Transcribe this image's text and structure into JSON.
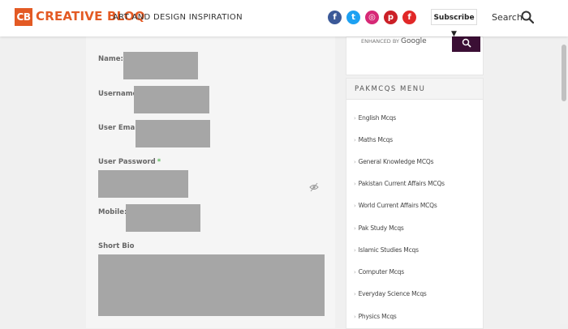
{
  "header": {
    "logo_mark": "CB",
    "logo_text": "CREATIVE BLOQ",
    "tagline": "ART AND DESIGN INSPIRATION",
    "social": [
      {
        "icon": "facebook-icon",
        "glyph": "f",
        "color": "#3b5998"
      },
      {
        "icon": "twitter-icon",
        "glyph": "t",
        "color": "#1da1f2"
      },
      {
        "icon": "instagram-icon",
        "glyph": "◎",
        "color": "#d62976"
      },
      {
        "icon": "pinterest-icon",
        "glyph": "p",
        "color": "#cb2027"
      },
      {
        "icon": "flipboard-icon",
        "glyph": "f",
        "color": "#e12828"
      }
    ],
    "subscribe_label": "Subscribe ▼",
    "search_label": "Search"
  },
  "form": {
    "name_label": "Name:",
    "username_label": "Username",
    "email_label": "User Email",
    "password_label": "User Password",
    "mobile_label": "Mobile:",
    "bio_label": "Short Bio",
    "required_mark": "*"
  },
  "sidebar": {
    "search_enhanced": "ENHANCED BY",
    "search_google": "Google",
    "menu_title": "PAKMCQS MENU",
    "menu_items": [
      "English Mcqs",
      "Maths Mcqs",
      "General Knowledge MCQs",
      "Pakistan Current Affairs MCQs",
      "World Current Affairs MCQs",
      "Pak Study Mcqs",
      "Islamic Studies Mcqs",
      "Computer Mcqs",
      "Everyday Science Mcqs",
      "Physics Mcqs"
    ]
  },
  "colors": {
    "brand": "#e35a24",
    "search_button": "#3b0f35",
    "required": "#5cb85c"
  }
}
